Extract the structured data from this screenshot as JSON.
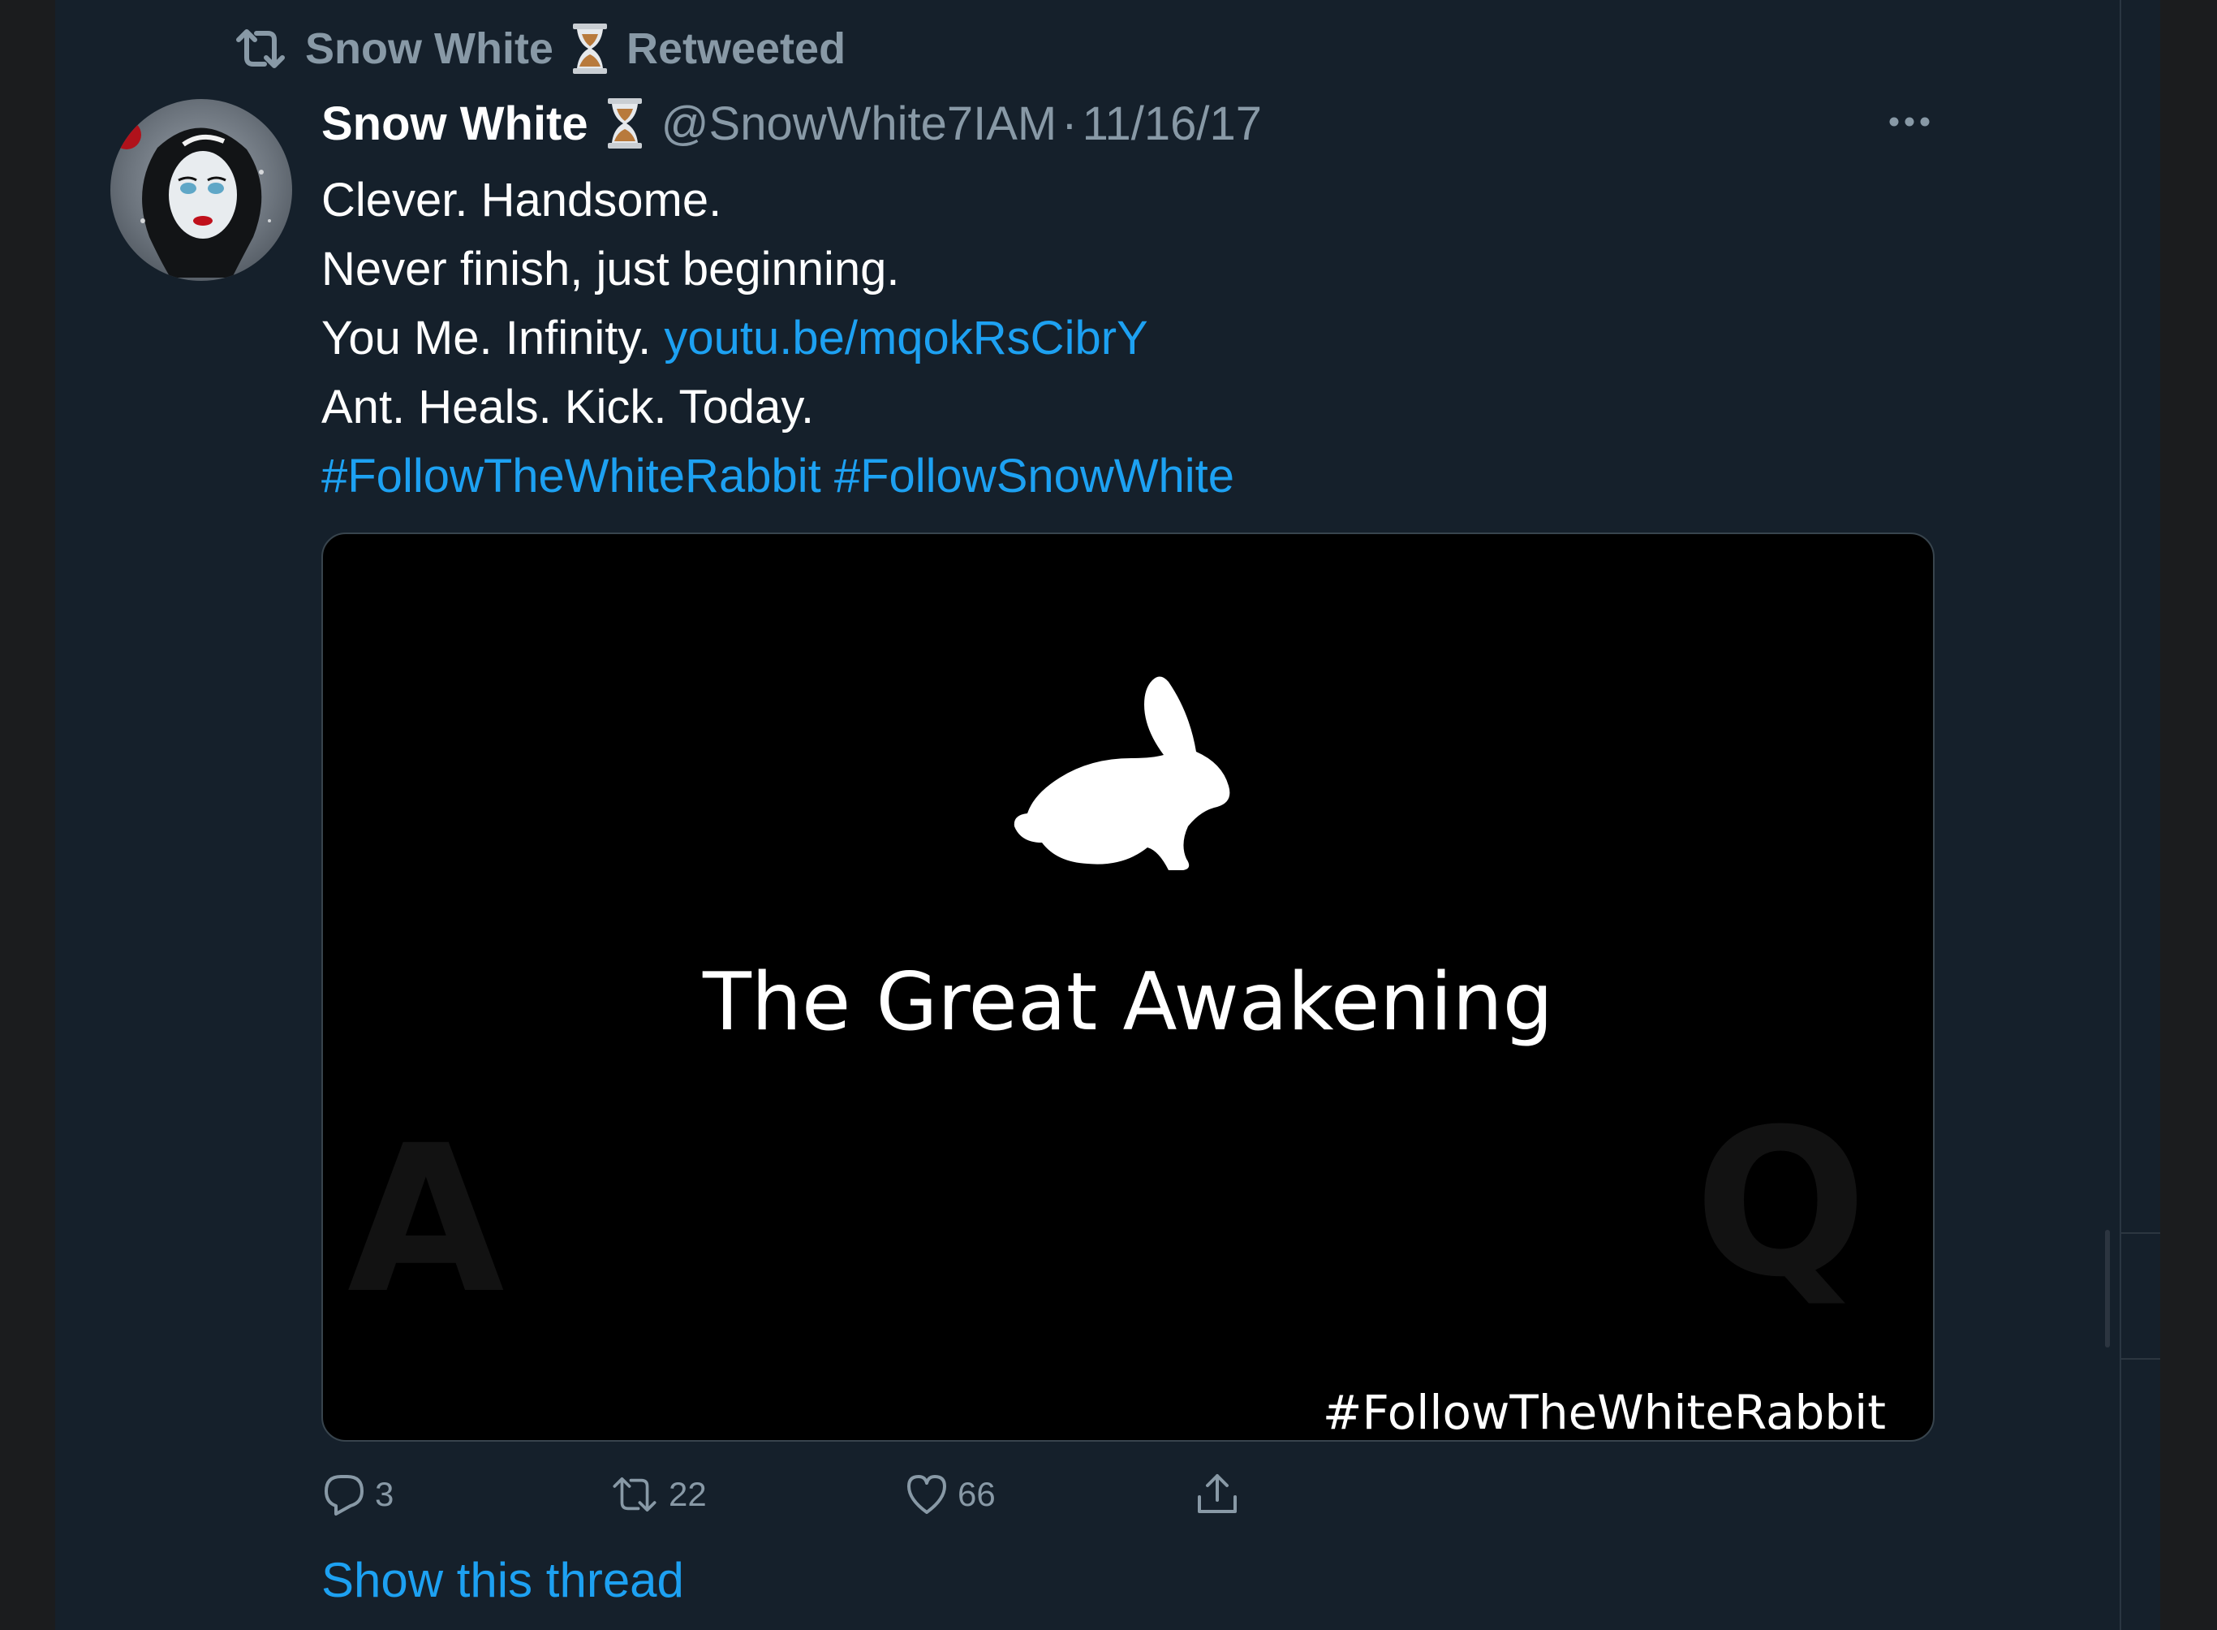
{
  "retweet_context": {
    "name": "Snow White",
    "label": "Retweeted"
  },
  "tweet": {
    "display_name": "Snow White",
    "handle": "@SnowWhite7IAM",
    "separator": "·",
    "date": "11/16/17",
    "lines": {
      "l1": "Clever. Handsome.",
      "l2": "Never finish, just beginning.",
      "l3_text": "You Me. Infinity. ",
      "l3_link": "youtu.be/mqokRsCibrY",
      "l4": "Ant. Heals. Kick. Today.",
      "hashtag1": "#FollowTheWhiteRabbit",
      "hashtag2": "#FollowSnowWhite"
    }
  },
  "media": {
    "title": "The Great Awakening",
    "watermark_left": "A",
    "watermark_right": "Q",
    "hashtag": "#FollowTheWhiteRabbit"
  },
  "actions": {
    "replies": "3",
    "retweets": "22",
    "likes": "66"
  },
  "show_thread_label": "Show this thread",
  "icons": {
    "retweet": "retweet-icon",
    "hourglass": "hourglass-icon",
    "more": "more-horizontal-icon",
    "reply": "reply-icon",
    "like": "heart-icon",
    "share": "share-icon"
  },
  "colors": {
    "background": "#15202b",
    "accent": "#1da1f2",
    "muted": "#8899a6",
    "text": "#ffffff"
  }
}
